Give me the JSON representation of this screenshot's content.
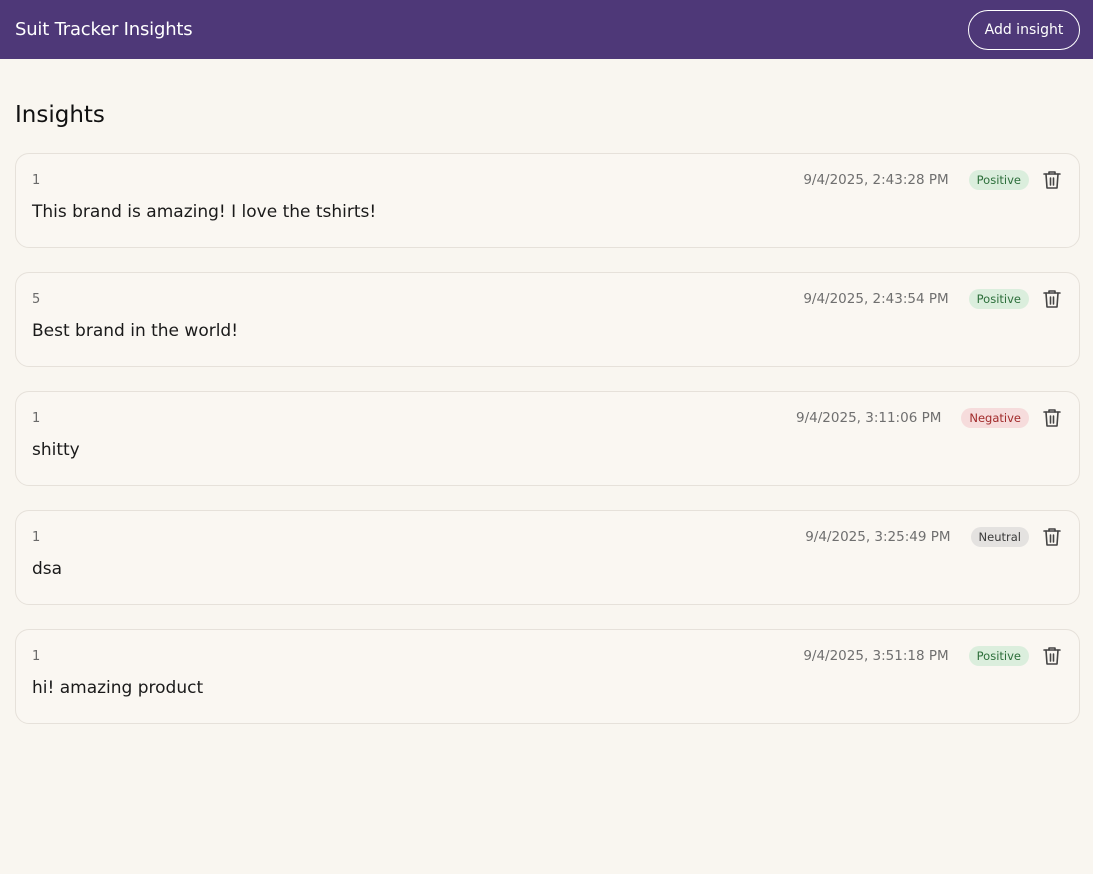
{
  "header": {
    "app_title": "Suit Tracker Insights",
    "add_button_label": "Add insight"
  },
  "page": {
    "title": "Insights"
  },
  "insights": [
    {
      "brand": "1",
      "timestamp": "9/4/2025, 2:43:28 PM",
      "sentiment": "Positive",
      "sentiment_key": "positive",
      "text": "This brand is amazing! I love the tshirts!"
    },
    {
      "brand": "5",
      "timestamp": "9/4/2025, 2:43:54 PM",
      "sentiment": "Positive",
      "sentiment_key": "positive",
      "text": "Best brand in the world!"
    },
    {
      "brand": "1",
      "timestamp": "9/4/2025, 3:11:06 PM",
      "sentiment": "Negative",
      "sentiment_key": "negative",
      "text": "shitty"
    },
    {
      "brand": "1",
      "timestamp": "9/4/2025, 3:25:49 PM",
      "sentiment": "Neutral",
      "sentiment_key": "neutral",
      "text": "dsa"
    },
    {
      "brand": "1",
      "timestamp": "9/4/2025, 3:51:18 PM",
      "sentiment": "Positive",
      "sentiment_key": "positive",
      "text": "hi! amazing product"
    }
  ],
  "colors": {
    "header_bg": "#4e3878",
    "page_bg": "#f9f6f0",
    "positive_bg": "#dbeedd",
    "negative_bg": "#f6dcdc",
    "neutral_bg": "#e4e2e0"
  },
  "icons": {
    "delete": "trash-icon"
  }
}
